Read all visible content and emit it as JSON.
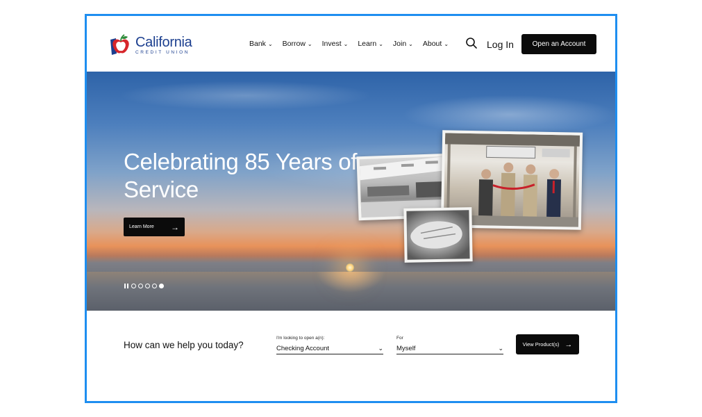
{
  "brand": {
    "name": "California",
    "subtitle": "CREDIT UNION",
    "colors": {
      "primary": "#1c3f8f",
      "apple_red": "#d6262b",
      "leaf_green": "#2e8b3a",
      "frame_border": "#1e8ef0"
    }
  },
  "nav": {
    "items": [
      {
        "label": "Bank"
      },
      {
        "label": "Borrow"
      },
      {
        "label": "Invest"
      },
      {
        "label": "Learn"
      },
      {
        "label": "Join"
      },
      {
        "label": "About"
      }
    ],
    "search_icon": "search-icon",
    "login_label": "Log In",
    "open_account_label": "Open an Account"
  },
  "hero": {
    "title": "Celebrating 85 Years of Service",
    "cta_label": "Learn More",
    "slides_total": 5,
    "active_slide": 5
  },
  "help": {
    "prompt": "How can we help you today?",
    "field1": {
      "label": "I'm looking to open a(n):",
      "value": "Checking Account"
    },
    "field2": {
      "label": "For",
      "value": "Myself"
    },
    "submit_label": "View Product(s)"
  }
}
